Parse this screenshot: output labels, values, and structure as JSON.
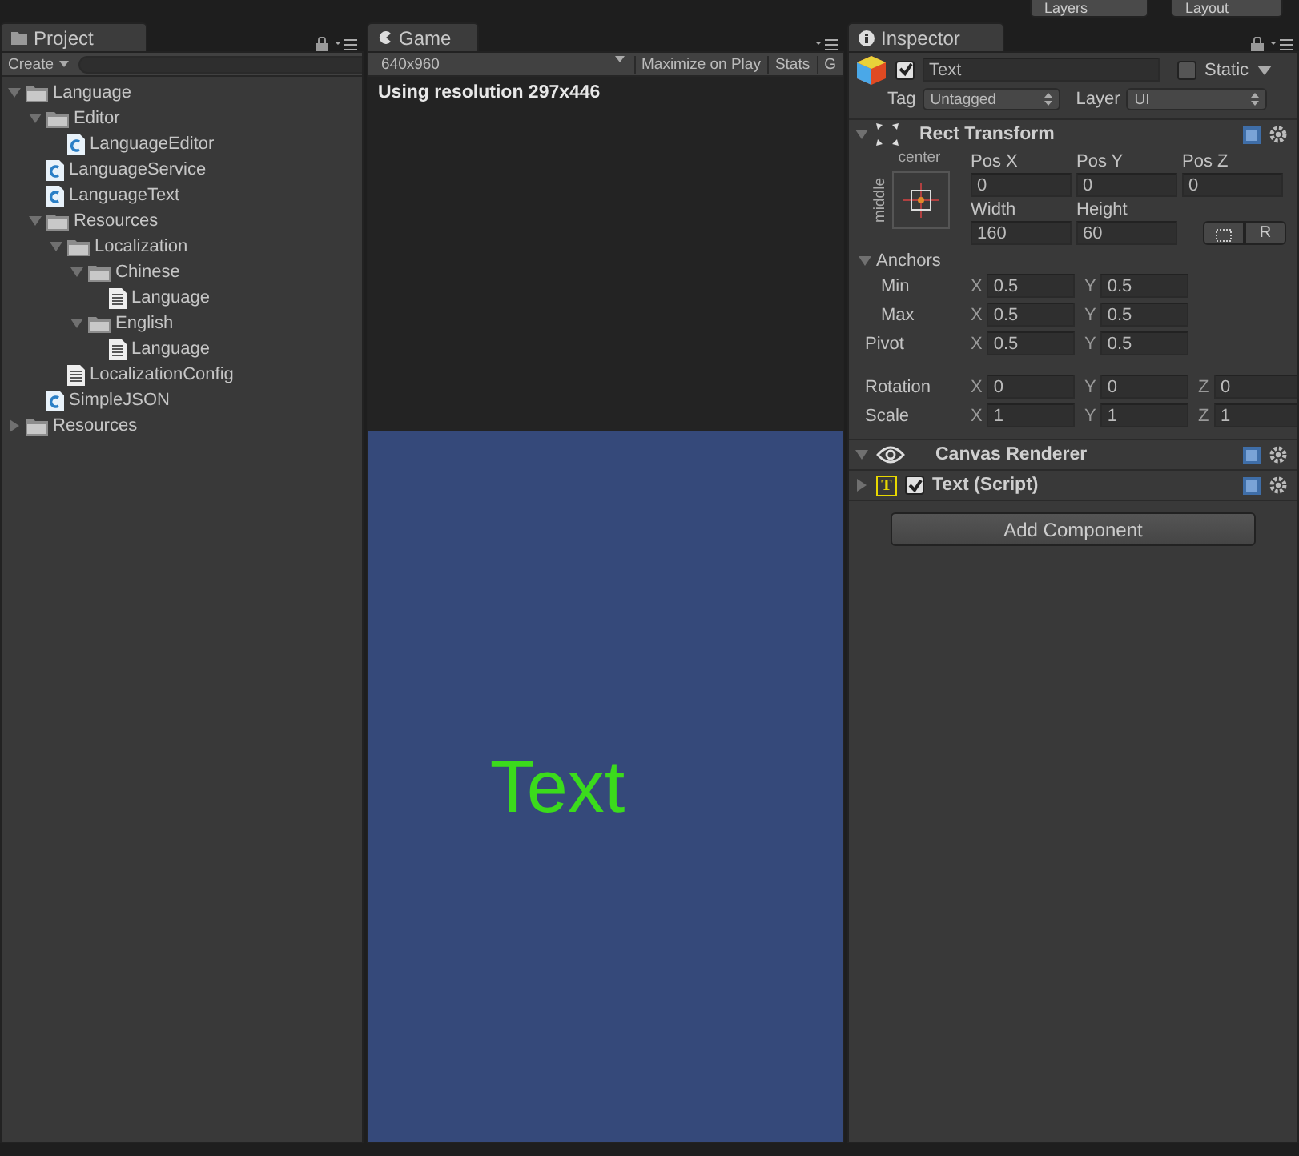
{
  "top_bar": {
    "buttons": [
      "Layers",
      "Layout"
    ]
  },
  "project": {
    "tab": "Project",
    "create": "Create",
    "tree": [
      {
        "kind": "folder",
        "name": "Language",
        "expanded": true,
        "children": [
          {
            "kind": "folder",
            "name": "Editor",
            "expanded": true,
            "children": [
              {
                "kind": "script",
                "name": "LanguageEditor"
              }
            ]
          },
          {
            "kind": "script",
            "name": "LanguageService"
          },
          {
            "kind": "script",
            "name": "LanguageText"
          },
          {
            "kind": "folder",
            "name": "Resources",
            "expanded": true,
            "children": [
              {
                "kind": "folder",
                "name": "Localization",
                "expanded": true,
                "children": [
                  {
                    "kind": "folder",
                    "name": "Chinese",
                    "expanded": true,
                    "children": [
                      {
                        "kind": "text",
                        "name": "Language"
                      }
                    ]
                  },
                  {
                    "kind": "folder",
                    "name": "English",
                    "expanded": true,
                    "children": [
                      {
                        "kind": "text",
                        "name": "Language"
                      }
                    ]
                  }
                ]
              },
              {
                "kind": "text",
                "name": "LocalizationConfig"
              }
            ]
          },
          {
            "kind": "script",
            "name": "SimpleJSON"
          }
        ]
      },
      {
        "kind": "folder",
        "name": "Resources",
        "expanded": false
      }
    ]
  },
  "game": {
    "tab": "Game",
    "resolution": "640x960",
    "buttons": [
      "Maximize on Play",
      "Stats",
      "G"
    ],
    "info": "Using resolution 297x446",
    "canvas_text": "Text"
  },
  "inspector": {
    "tab": "Inspector",
    "object": {
      "active": true,
      "name": "Text",
      "static": false,
      "static_label": "Static",
      "tag_label": "Tag",
      "tag": "Untagged",
      "layer_label": "Layer",
      "layer": "UI"
    },
    "rect_transform": {
      "title": "Rect Transform",
      "expanded": true,
      "anchor_h": "center",
      "anchor_v": "middle",
      "top_labels": [
        "Pos X",
        "Pos Y",
        "Pos Z"
      ],
      "top_values": [
        "0",
        "0",
        "0"
      ],
      "size_labels": [
        "Width",
        "Height"
      ],
      "size_values": [
        "160",
        "60"
      ],
      "raw_button": "R",
      "anchors_label": "Anchors",
      "anchors_expanded": true,
      "rows": [
        {
          "label": "Min",
          "indent": true,
          "fields": [
            {
              "axis": "X",
              "value": "0.5"
            },
            {
              "axis": "Y",
              "value": "0.5"
            }
          ]
        },
        {
          "label": "Max",
          "indent": true,
          "fields": [
            {
              "axis": "X",
              "value": "0.5"
            },
            {
              "axis": "Y",
              "value": "0.5"
            }
          ]
        },
        {
          "label": "Pivot",
          "indent": false,
          "fields": [
            {
              "axis": "X",
              "value": "0.5"
            },
            {
              "axis": "Y",
              "value": "0.5"
            }
          ]
        },
        {
          "label": "Rotation",
          "indent": false,
          "gap": true,
          "fields": [
            {
              "axis": "X",
              "value": "0"
            },
            {
              "axis": "Y",
              "value": "0"
            },
            {
              "axis": "Z",
              "value": "0"
            }
          ]
        },
        {
          "label": "Scale",
          "indent": false,
          "fields": [
            {
              "axis": "X",
              "value": "1"
            },
            {
              "axis": "Y",
              "value": "1"
            },
            {
              "axis": "Z",
              "value": "1"
            }
          ]
        }
      ]
    },
    "components": [
      {
        "kind": "eye",
        "title": "Canvas Renderer",
        "expanded": true
      },
      {
        "kind": "text",
        "title": "Text (Script)",
        "expanded": false,
        "enabled": true,
        "badge": "T"
      }
    ],
    "add_button": "Add Component"
  }
}
